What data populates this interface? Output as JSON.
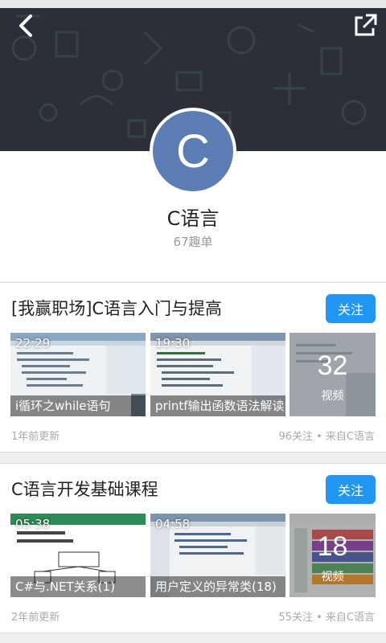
{
  "header": {
    "back_icon": "chevron-left-icon",
    "share_icon": "external-link-icon",
    "background": "#2b3038"
  },
  "profile": {
    "avatar_letter": "C",
    "avatar_color": "#5b7db3",
    "name": "C语言",
    "subtitle": "67趣单"
  },
  "collections": [
    {
      "title": "[我赢职场]C语言入门与提高",
      "follow_label": "关注",
      "videos": [
        {
          "duration": "22:29",
          "caption": "i循环之while语句"
        },
        {
          "duration": "19:30",
          "caption": "printf输出函数语法解读"
        }
      ],
      "more_count": "32",
      "more_unit": "视频",
      "updated": "1年前更新",
      "stats": "96关注 • 来自C语言"
    },
    {
      "title": "C语言开发基础课程",
      "follow_label": "关注",
      "videos": [
        {
          "duration": "05:38",
          "caption": "C#与.NET关系(1)"
        },
        {
          "duration": "04:58",
          "caption": "用户定义的异常类(18)"
        }
      ],
      "more_count": "18",
      "more_unit": "视频",
      "updated": "2年前更新",
      "stats": "55关注 • 来自C语言"
    }
  ],
  "accent_color": "#2196f3"
}
